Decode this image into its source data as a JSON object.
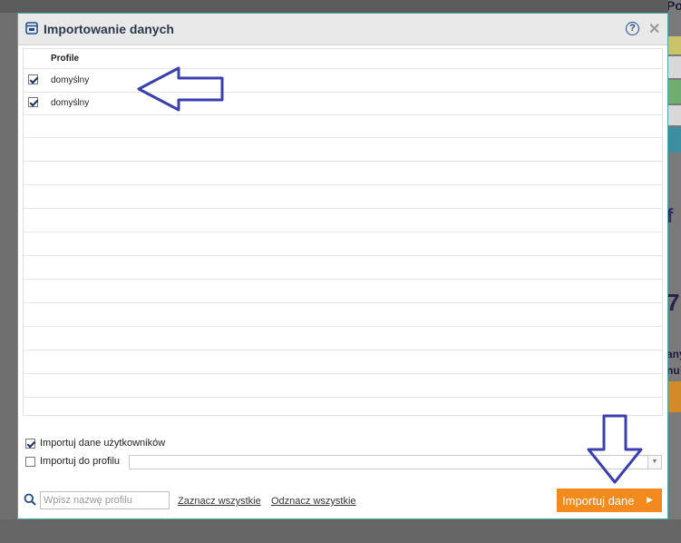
{
  "dialog": {
    "title": "Importowanie danych",
    "help_label": "?",
    "close_label": "✕"
  },
  "table": {
    "column_header": "Profile",
    "rows": [
      {
        "label": "domyślny",
        "checked": true
      },
      {
        "label": "domyślny",
        "checked": true
      }
    ]
  },
  "options": {
    "import_users": {
      "label": "Importuj dane użytkowników",
      "checked": true
    },
    "import_to_profile": {
      "label": "Importuj do profilu",
      "checked": false
    }
  },
  "footer": {
    "search_placeholder": "Wpisz nazwę profilu",
    "select_all": "Zaznacz wszystkie",
    "deselect_all": "Odznacz wszystkie",
    "import_button": "Importuj dane"
  },
  "background": {
    "right_fragments": [
      "Podsum",
      "f",
      "7",
      "any",
      "nu"
    ]
  },
  "colors": {
    "accent_orange": "#f28a1e",
    "dialog_border": "#4aa8a8",
    "annotation_arrow": "#3a3fb0"
  }
}
